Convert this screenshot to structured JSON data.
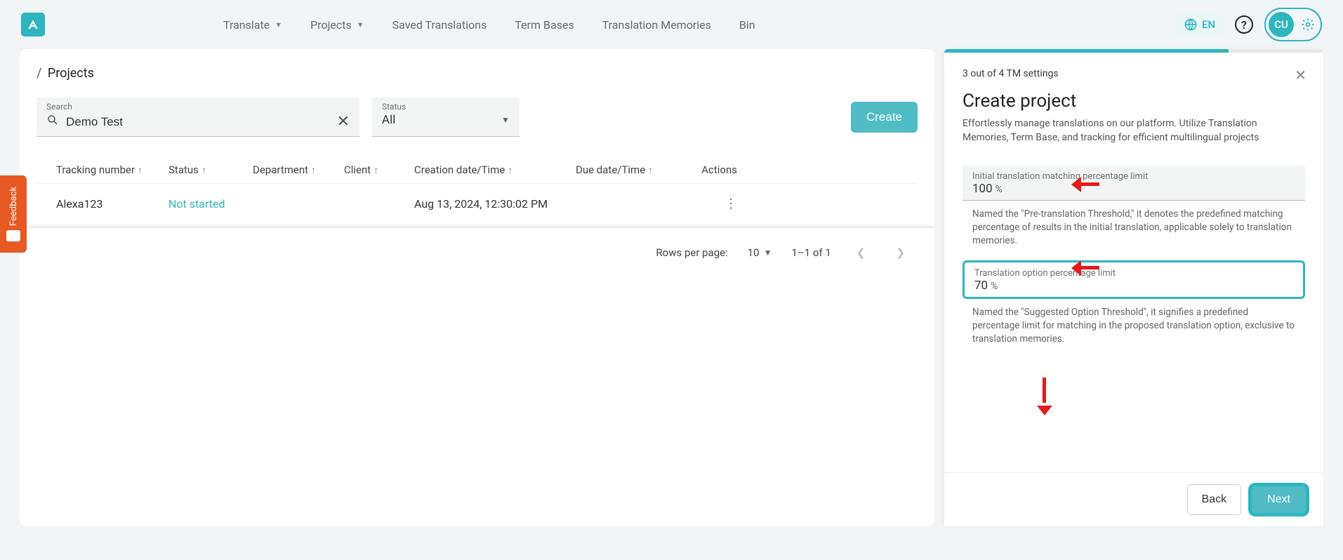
{
  "nav": {
    "translate": "Translate",
    "projects": "Projects",
    "saved": "Saved Translations",
    "termBases": "Term Bases",
    "memories": "Translation Memories",
    "bin": "Bin",
    "lang": "EN",
    "avatar": "CU"
  },
  "bread": {
    "slash": "/",
    "projects": "Projects"
  },
  "filters": {
    "searchLabel": "Search",
    "searchValue": "Demo Test",
    "statusLabel": "Status",
    "statusValue": "All",
    "createBtn": "Create"
  },
  "table": {
    "cols": {
      "tracking": "Tracking number",
      "status": "Status",
      "department": "Department",
      "client": "Client",
      "creation": "Creation date/Time",
      "due": "Due date/Time",
      "actions": "Actions"
    },
    "row": {
      "tracking": "Alexa123",
      "status": "Not started",
      "creation": "Aug 13, 2024, 12:30:02 PM"
    }
  },
  "pager": {
    "rowsLabel": "Rows per page:",
    "rows": "10",
    "range": "1–1 of 1"
  },
  "panel": {
    "step": "3 out of 4 TM settings",
    "title": "Create project",
    "desc": "Effortlessly manage translations on our platform. Utilize Translation Memories, Term Base, and tracking for efficient multilingual projects",
    "field1": {
      "label": "Initial translation matching percentage limit",
      "value": "100",
      "unit": "%",
      "help": "Named the \"Pre-translation Threshold,\" it denotes the predefined matching percentage of results in the initial translation, applicable solely to translation memories."
    },
    "field2": {
      "label": "Translation option percentage limit",
      "value": "70",
      "unit": "%",
      "help": "Named the \"Suggested Option Threshold\", it signifies a predefined percentage limit for matching in the proposed translation option, exclusive to translation memories."
    },
    "progressPct": "75%",
    "back": "Back",
    "next": "Next"
  },
  "feedback": "Feedback"
}
